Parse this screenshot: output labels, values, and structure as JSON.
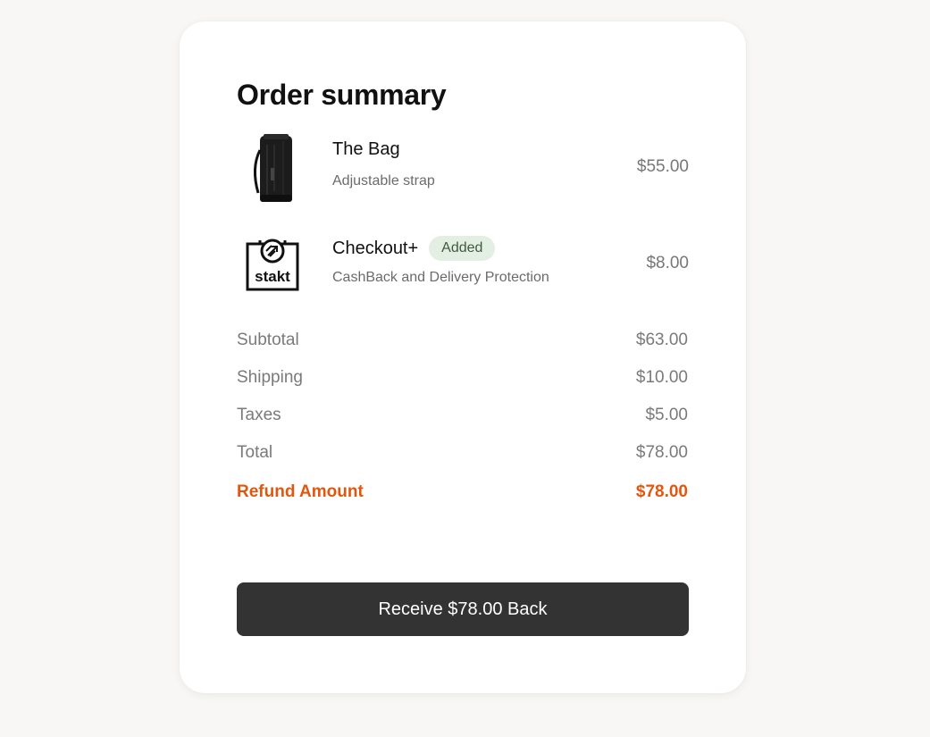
{
  "summary": {
    "title": "Order summary"
  },
  "items": [
    {
      "name": "The Bag",
      "description": "Adjustable strap",
      "price": "$55.00",
      "icon": "bag-icon"
    },
    {
      "name": "Checkout+",
      "badge": "Added",
      "description": "CashBack and Delivery Protection",
      "price": "$8.00",
      "icon": "stakt-logo-icon",
      "logo_text": "stakt"
    }
  ],
  "totals": [
    {
      "label": "Subtotal",
      "value": "$63.00"
    },
    {
      "label": "Shipping",
      "value": "$10.00"
    },
    {
      "label": "Taxes",
      "value": "$5.00"
    },
    {
      "label": "Total",
      "value": "$78.00"
    }
  ],
  "refund": {
    "label": "Refund Amount",
    "value": "$78.00",
    "color": "#e2570f"
  },
  "cta": {
    "label": "Receive $78.00 Back"
  },
  "colors": {
    "background": "#f8f7f5",
    "card": "#ffffff",
    "button": "#333333",
    "badge_bg": "#e4efe4",
    "accent": "#e2570f"
  }
}
